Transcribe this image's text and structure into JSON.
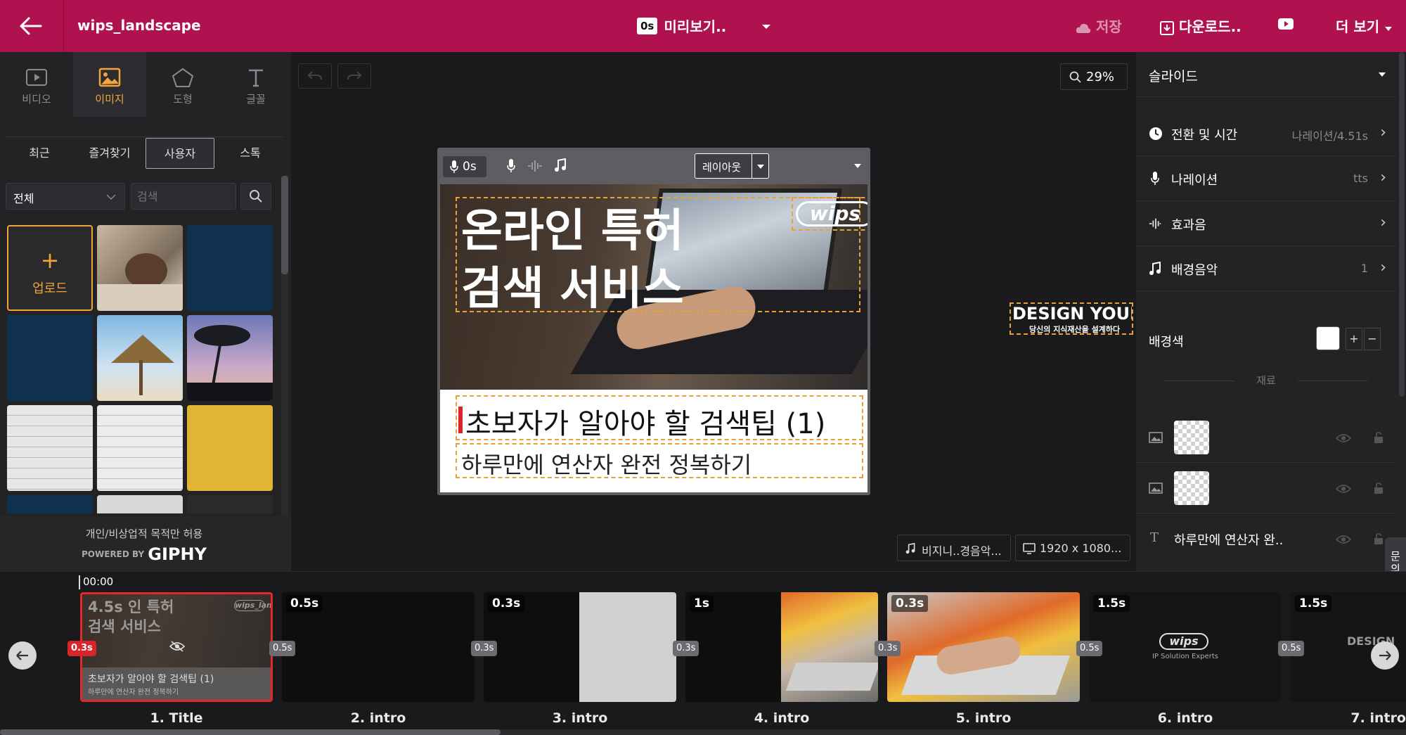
{
  "header": {
    "title": "wips_landscape",
    "preview_time": "0s",
    "preview_label": "미리보기..",
    "save_label": "저장",
    "download_label": "다운로드..",
    "more_label": "더 보기"
  },
  "left_panel": {
    "tools": [
      {
        "label": "비디오",
        "icon": "video-icon"
      },
      {
        "label": "이미지",
        "icon": "image-icon"
      },
      {
        "label": "도형",
        "icon": "shape-icon"
      },
      {
        "label": "글꼴",
        "icon": "font-icon"
      }
    ],
    "tabs": [
      "최근",
      "즐겨찾기",
      "사용자",
      "스톡"
    ],
    "active_tab": "사용자",
    "filter_value": "전체",
    "search_placeholder": "검색",
    "upload_label": "업로드",
    "footer_note": "개인/비상업적 목적만 허용",
    "powered_by": "POWERED BY",
    "giphy": "GIPHY"
  },
  "canvas": {
    "zoom": "29%",
    "narration_time": "0s",
    "layout_label": "레이아웃",
    "slide_title": "온라인 특허\n검색 서비스",
    "logo_text": "wips",
    "subtitle": "초보자가 알아야 할 검색팁 (1)",
    "subtext": "하루만에 연산자 완전 정복하기",
    "offcanvas_title": "DESIGN YOUR I",
    "offcanvas_sub": "당신의 지식재산을 설계하다",
    "bgm_chip": "비지니..경음악...",
    "resolution_chip": "1920 x 1080..."
  },
  "right_panel": {
    "section_title": "슬라이드",
    "rows": [
      {
        "label": "전환 및 시간",
        "value": "나레이션/4.51s",
        "icon": "clock-icon"
      },
      {
        "label": "나레이션",
        "value": "tts",
        "icon": "mic-icon"
      },
      {
        "label": "효과음",
        "value": "",
        "icon": "sound-effect-icon"
      },
      {
        "label": "배경음악",
        "value": "1",
        "icon": "music-note-icon"
      }
    ],
    "bg_color_label": "배경색",
    "bg_color": "#ffffff",
    "materials_label": "재료",
    "materials": [
      {
        "type": "image",
        "name": ""
      },
      {
        "type": "image",
        "name": ""
      },
      {
        "type": "text",
        "name": "하루만에 연산자 완.."
      }
    ],
    "side_tab": "문의"
  },
  "timeline": {
    "time": "00:00",
    "clips": [
      {
        "label": "1. Title",
        "duration": "4.5s",
        "transition": "0.3s"
      },
      {
        "label": "2. intro",
        "duration": "0.5s",
        "transition": "0.5s"
      },
      {
        "label": "3. intro",
        "duration": "0.3s",
        "transition": "0.3s"
      },
      {
        "label": "4. intro",
        "duration": "1s",
        "transition": "0.3s"
      },
      {
        "label": "5. intro",
        "duration": "0.3s",
        "transition": "0.3s"
      },
      {
        "label": "6. intro",
        "duration": "1.5s",
        "transition": "0.5s"
      },
      {
        "label": "7. intro",
        "duration": "1.5s",
        "transition": "0.5s"
      }
    ],
    "clip1_title": "4.5s 인 특허\n검색 서비스",
    "clip1_sub": "초보자가 알아야 할 검색팁 (1)",
    "clip1_sub2": "하루만에 연산자 완전 정복하기",
    "clip6_logo": "wips",
    "clip6_tagline": "IP Solution Experts",
    "clip7_text": "DESIGN"
  }
}
